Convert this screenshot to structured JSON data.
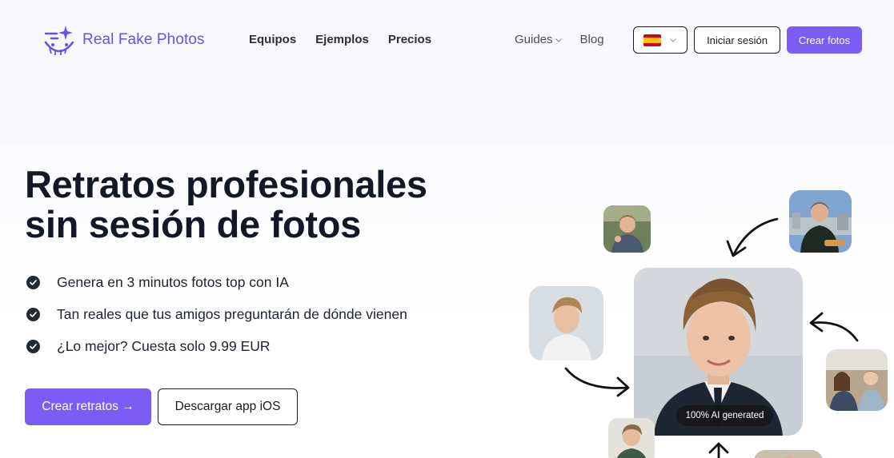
{
  "header": {
    "logo_text": "Real Fake Photos",
    "nav": [
      "Equipos",
      "Ejemplos",
      "Precios"
    ],
    "guides_label": "Guides",
    "blog_label": "Blog",
    "language": "es",
    "login_label": "Iniciar sesión",
    "create_label": "Crear fotos"
  },
  "hero": {
    "title_line1": "Retratos profesionales",
    "title_line2": "sin sesión de fotos",
    "features": [
      "Genera en 3 minutos fotos top con IA",
      "Tan reales que tus amigos preguntarán de dónde vienen",
      "¿Lo mejor? Cuesta solo 9.99 EUR"
    ],
    "cta_primary": "Crear retratos →",
    "cta_secondary": "Descargar app iOS"
  },
  "gallery": {
    "badge": "100% AI generated"
  },
  "colors": {
    "brand": "#7b5cf5",
    "logo": "#6c4fe8",
    "text_dark": "#121826",
    "background": "#f9f8fe"
  },
  "icons": [
    "logo-sparkle-smile-icon",
    "chevron-down-icon",
    "spain-flag-icon",
    "check-circle-icon",
    "curved-arrow-icon"
  ]
}
